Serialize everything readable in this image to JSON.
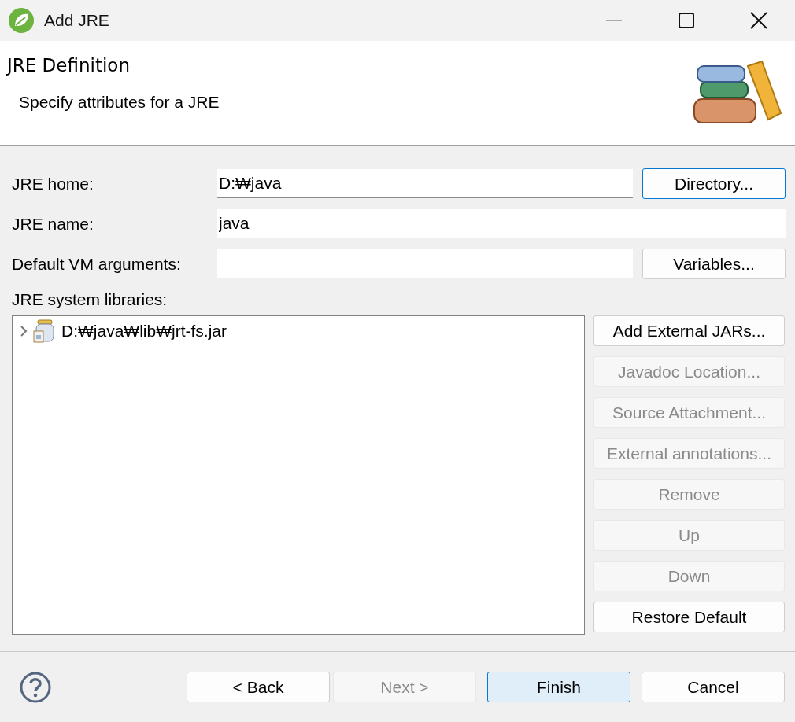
{
  "window": {
    "title": "Add JRE"
  },
  "header": {
    "title": "JRE Definition",
    "description": "Specify attributes for a JRE"
  },
  "fields": [
    {
      "label": "JRE home:",
      "value": "D:₩java",
      "button": {
        "label": "Directory...",
        "focused": true
      }
    },
    {
      "label": "JRE name:",
      "value": "java"
    },
    {
      "label": "Default VM arguments:",
      "button": {
        "label": "Variables...",
        "focused": false
      }
    }
  ],
  "libraries": {
    "label": "JRE system libraries:",
    "items": [
      {
        "label": "D:₩java₩lib₩jrt-fs.jar",
        "expanded": false
      }
    ],
    "buttons": [
      {
        "label": "Add External JARs...",
        "disabled": false
      },
      {
        "label": "Javadoc Location...",
        "disabled": true
      },
      {
        "label": "Source Attachment...",
        "disabled": true
      },
      {
        "label": "External annotations...",
        "disabled": true
      },
      {
        "label": "Remove",
        "disabled": true
      },
      {
        "label": "Up",
        "disabled": true
      },
      {
        "label": "Down",
        "disabled": true
      },
      {
        "label": "Restore Default",
        "disabled": false
      }
    ]
  },
  "footer": {
    "buttons": [
      {
        "label": "< Back",
        "disabled": false,
        "default": false
      },
      {
        "label": "Next >",
        "disabled": true,
        "default": false
      },
      {
        "label": "Finish",
        "disabled": false,
        "default": true
      },
      {
        "label": "Cancel",
        "disabled": false,
        "default": false
      }
    ]
  }
}
